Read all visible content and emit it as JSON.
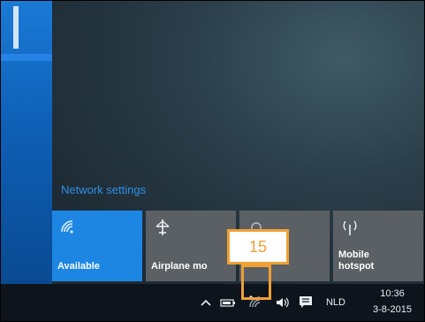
{
  "action_center": {
    "network_settings_link": "Network settings",
    "tiles": [
      {
        "label": "Available",
        "icon": "wifi-icon",
        "active": true
      },
      {
        "label": "Airplane mo",
        "icon": "airplane-icon",
        "active": false
      },
      {
        "label": "",
        "icon": "",
        "active": false
      },
      {
        "label": "Mobile\nhotspot",
        "icon": "hotspot-icon",
        "active": false
      }
    ]
  },
  "annotation": {
    "callout_number": "15"
  },
  "taskbar": {
    "tray_icons": [
      "chevron-up-icon",
      "battery-icon",
      "wifi-icon",
      "speaker-icon",
      "notifications-icon"
    ],
    "language": "NLD",
    "time": "10:36",
    "date": "3-8-2015"
  },
  "colors": {
    "accent_blue": "#1d86e3",
    "callout_orange": "#f0a035",
    "taskbar_bg": "#0d141c"
  }
}
